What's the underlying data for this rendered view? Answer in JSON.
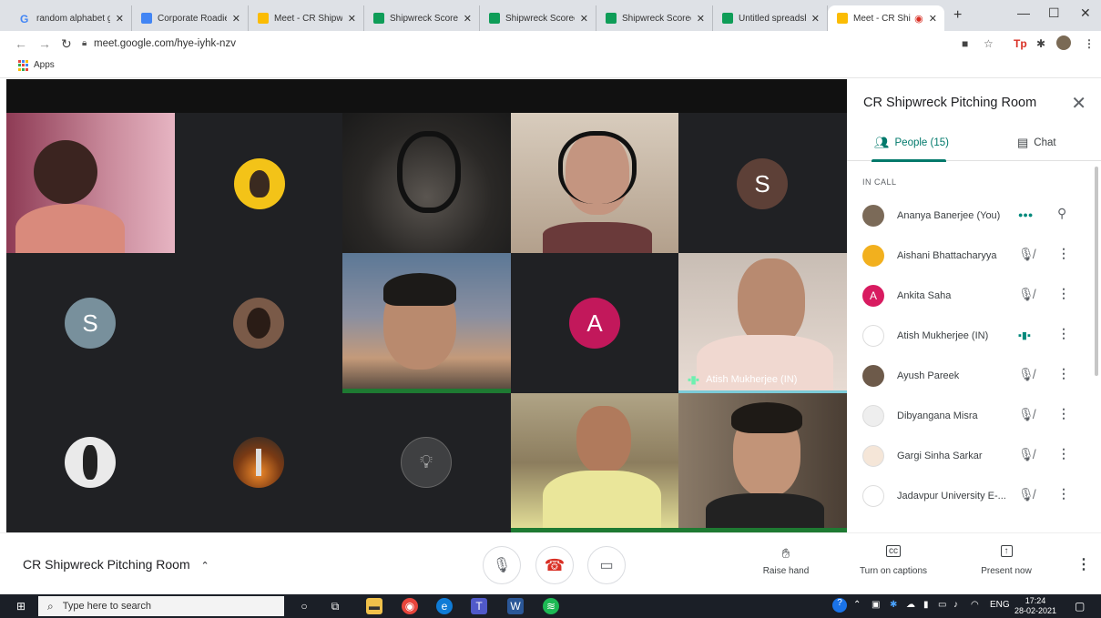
{
  "browser": {
    "tabs": [
      {
        "title": "random alphabet g",
        "color": "#4285f4",
        "glyph": "G"
      },
      {
        "title": "Corporate Roadies",
        "color": "#4285f4",
        "glyph": "≡"
      },
      {
        "title": "Meet - CR Shipwre",
        "color": "#fbbc04",
        "glyph": "▶"
      },
      {
        "title": "Shipwreck Scoreca",
        "color": "#0f9d58",
        "glyph": "+"
      },
      {
        "title": "Shipwreck Scoreca",
        "color": "#0f9d58",
        "glyph": "+"
      },
      {
        "title": "Shipwreck Scoreca",
        "color": "#0f9d58",
        "glyph": "+"
      },
      {
        "title": "Untitled spreadshe",
        "color": "#0f9d58",
        "glyph": "+"
      },
      {
        "title": "Meet - CR Shi",
        "color": "#fbbc04",
        "glyph": "▶"
      }
    ],
    "url": "meet.google.com/hye-iyhk-nzv",
    "bookmarks_label": "Apps"
  },
  "meeting": {
    "room_name": "CR Shipwreck Pitching Room",
    "tiles": [
      {
        "kind": "avatar",
        "letter": "S",
        "color": "#5d4037"
      },
      {
        "kind": "avatar",
        "letter": "S",
        "color": "#78909c"
      },
      {
        "kind": "avatar",
        "letter": "A",
        "color": "#c2185b"
      }
    ],
    "speaker_label": "Atish Mukherjee (IN)"
  },
  "sidebar": {
    "title": "CR Shipwreck Pitching Room",
    "people_tab": "People (15)",
    "chat_tab": "Chat",
    "section": "IN CALL",
    "people": [
      {
        "name": "Ananya Banerjee (You)",
        "avatar_color": "#7b6a58",
        "letter": ""
      },
      {
        "name": "Aishani Bhattacharyya",
        "avatar_color": "#f2b01e",
        "letter": ""
      },
      {
        "name": "Ankita Saha",
        "avatar_color": "#d81b60",
        "letter": "A"
      },
      {
        "name": "Atish Mukherjee (IN)",
        "avatar_color": "#ffffff",
        "letter": ""
      },
      {
        "name": "Ayush Pareek",
        "avatar_color": "#6d5a4a",
        "letter": ""
      },
      {
        "name": "Dibyangana Misra",
        "avatar_color": "#eeeeee",
        "letter": ""
      },
      {
        "name": "Gargi Sinha Sarkar",
        "avatar_color": "#f5e6d8",
        "letter": ""
      },
      {
        "name": "Jadavpur University E-...",
        "avatar_color": "#ffffff",
        "letter": ""
      }
    ]
  },
  "controls": {
    "raise_hand": "Raise hand",
    "captions": "Turn on captions",
    "present": "Present now"
  },
  "taskbar": {
    "search_placeholder": "Type here to search",
    "language": "ENG",
    "time": "17:24",
    "date": "28-02-2021"
  }
}
